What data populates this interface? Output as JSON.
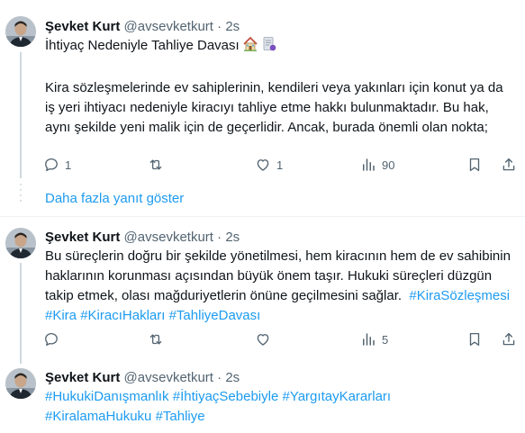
{
  "tweets": [
    {
      "author_name": "Şevket Kurt",
      "author_handle": "@avsevketkurt",
      "separator": "·",
      "time": "2s",
      "title": "İhtiyaç Nedeniyle Tahliye Davası",
      "text": "Kira sözleşmelerinde ev sahiplerinin, kendileri veya yakınları için konut ya da iş yeri ihtiyacı nedeniyle kiracıyı tahliye etme hakkı bulunmaktadır. Bu hak, aynı şekilde yeni malik için de geçerlidir. Ancak, burada önemli olan nokta;",
      "replies": "1",
      "retweets": "",
      "likes": "1",
      "views": "90"
    },
    {
      "author_name": "Şevket Kurt",
      "author_handle": "@avsevketkurt",
      "separator": "·",
      "time": "2s",
      "text": "Bu süreçlerin doğru bir şekilde yönetilmesi, hem kiracının hem de ev sahibinin haklarının korunması açısından büyük önem taşır. Hukuki süreçleri düzgün takip etmek, olası mağduriyetlerin önüne geçilmesini sağlar.",
      "hashtags": [
        "#KiraSözleşmesi",
        "#Kira",
        "#KiracıHakları",
        "#TahliyeDavası"
      ],
      "replies": "",
      "retweets": "",
      "likes": "",
      "views": "5"
    },
    {
      "author_name": "Şevket Kurt",
      "author_handle": "@avsevketkurt",
      "separator": "·",
      "time": "2s",
      "hashtags_line1": [
        "#HukukiDanışmanlık",
        "#İhtiyaçSebebiyle",
        "#YargıtayKararları"
      ],
      "hashtags_line2": [
        "#KiralamaHukuku",
        "#Tahliye"
      ]
    }
  ],
  "show_more_replies": "Daha fazla yanıt göster",
  "icons": [
    "reply-icon",
    "retweet-icon",
    "like-icon",
    "views-icon",
    "bookmark-icon",
    "share-icon",
    "house-emoji-icon",
    "document-emoji-icon"
  ],
  "colors": {
    "link": "#1d9bf0",
    "secondary_text": "#536471",
    "text": "#0f1419",
    "divider": "#eff3f4"
  }
}
